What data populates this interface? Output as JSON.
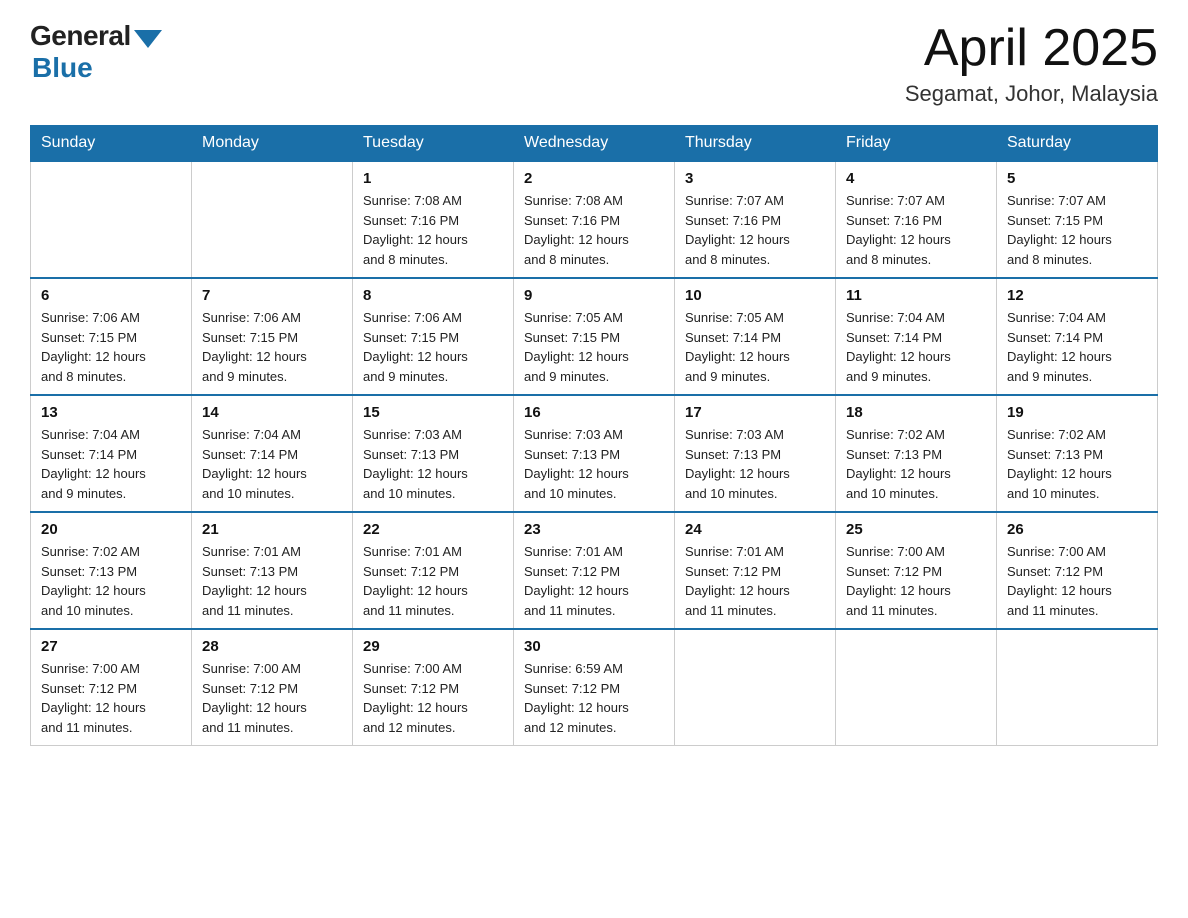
{
  "header": {
    "logo": {
      "general": "General",
      "blue": "Blue"
    },
    "title": "April 2025",
    "subtitle": "Segamat, Johor, Malaysia"
  },
  "weekdays": [
    "Sunday",
    "Monday",
    "Tuesday",
    "Wednesday",
    "Thursday",
    "Friday",
    "Saturday"
  ],
  "weeks": [
    [
      {
        "day": "",
        "info": ""
      },
      {
        "day": "",
        "info": ""
      },
      {
        "day": "1",
        "info": "Sunrise: 7:08 AM\nSunset: 7:16 PM\nDaylight: 12 hours\nand 8 minutes."
      },
      {
        "day": "2",
        "info": "Sunrise: 7:08 AM\nSunset: 7:16 PM\nDaylight: 12 hours\nand 8 minutes."
      },
      {
        "day": "3",
        "info": "Sunrise: 7:07 AM\nSunset: 7:16 PM\nDaylight: 12 hours\nand 8 minutes."
      },
      {
        "day": "4",
        "info": "Sunrise: 7:07 AM\nSunset: 7:16 PM\nDaylight: 12 hours\nand 8 minutes."
      },
      {
        "day": "5",
        "info": "Sunrise: 7:07 AM\nSunset: 7:15 PM\nDaylight: 12 hours\nand 8 minutes."
      }
    ],
    [
      {
        "day": "6",
        "info": "Sunrise: 7:06 AM\nSunset: 7:15 PM\nDaylight: 12 hours\nand 8 minutes."
      },
      {
        "day": "7",
        "info": "Sunrise: 7:06 AM\nSunset: 7:15 PM\nDaylight: 12 hours\nand 9 minutes."
      },
      {
        "day": "8",
        "info": "Sunrise: 7:06 AM\nSunset: 7:15 PM\nDaylight: 12 hours\nand 9 minutes."
      },
      {
        "day": "9",
        "info": "Sunrise: 7:05 AM\nSunset: 7:15 PM\nDaylight: 12 hours\nand 9 minutes."
      },
      {
        "day": "10",
        "info": "Sunrise: 7:05 AM\nSunset: 7:14 PM\nDaylight: 12 hours\nand 9 minutes."
      },
      {
        "day": "11",
        "info": "Sunrise: 7:04 AM\nSunset: 7:14 PM\nDaylight: 12 hours\nand 9 minutes."
      },
      {
        "day": "12",
        "info": "Sunrise: 7:04 AM\nSunset: 7:14 PM\nDaylight: 12 hours\nand 9 minutes."
      }
    ],
    [
      {
        "day": "13",
        "info": "Sunrise: 7:04 AM\nSunset: 7:14 PM\nDaylight: 12 hours\nand 9 minutes."
      },
      {
        "day": "14",
        "info": "Sunrise: 7:04 AM\nSunset: 7:14 PM\nDaylight: 12 hours\nand 10 minutes."
      },
      {
        "day": "15",
        "info": "Sunrise: 7:03 AM\nSunset: 7:13 PM\nDaylight: 12 hours\nand 10 minutes."
      },
      {
        "day": "16",
        "info": "Sunrise: 7:03 AM\nSunset: 7:13 PM\nDaylight: 12 hours\nand 10 minutes."
      },
      {
        "day": "17",
        "info": "Sunrise: 7:03 AM\nSunset: 7:13 PM\nDaylight: 12 hours\nand 10 minutes."
      },
      {
        "day": "18",
        "info": "Sunrise: 7:02 AM\nSunset: 7:13 PM\nDaylight: 12 hours\nand 10 minutes."
      },
      {
        "day": "19",
        "info": "Sunrise: 7:02 AM\nSunset: 7:13 PM\nDaylight: 12 hours\nand 10 minutes."
      }
    ],
    [
      {
        "day": "20",
        "info": "Sunrise: 7:02 AM\nSunset: 7:13 PM\nDaylight: 12 hours\nand 10 minutes."
      },
      {
        "day": "21",
        "info": "Sunrise: 7:01 AM\nSunset: 7:13 PM\nDaylight: 12 hours\nand 11 minutes."
      },
      {
        "day": "22",
        "info": "Sunrise: 7:01 AM\nSunset: 7:12 PM\nDaylight: 12 hours\nand 11 minutes."
      },
      {
        "day": "23",
        "info": "Sunrise: 7:01 AM\nSunset: 7:12 PM\nDaylight: 12 hours\nand 11 minutes."
      },
      {
        "day": "24",
        "info": "Sunrise: 7:01 AM\nSunset: 7:12 PM\nDaylight: 12 hours\nand 11 minutes."
      },
      {
        "day": "25",
        "info": "Sunrise: 7:00 AM\nSunset: 7:12 PM\nDaylight: 12 hours\nand 11 minutes."
      },
      {
        "day": "26",
        "info": "Sunrise: 7:00 AM\nSunset: 7:12 PM\nDaylight: 12 hours\nand 11 minutes."
      }
    ],
    [
      {
        "day": "27",
        "info": "Sunrise: 7:00 AM\nSunset: 7:12 PM\nDaylight: 12 hours\nand 11 minutes."
      },
      {
        "day": "28",
        "info": "Sunrise: 7:00 AM\nSunset: 7:12 PM\nDaylight: 12 hours\nand 11 minutes."
      },
      {
        "day": "29",
        "info": "Sunrise: 7:00 AM\nSunset: 7:12 PM\nDaylight: 12 hours\nand 12 minutes."
      },
      {
        "day": "30",
        "info": "Sunrise: 6:59 AM\nSunset: 7:12 PM\nDaylight: 12 hours\nand 12 minutes."
      },
      {
        "day": "",
        "info": ""
      },
      {
        "day": "",
        "info": ""
      },
      {
        "day": "",
        "info": ""
      }
    ]
  ]
}
